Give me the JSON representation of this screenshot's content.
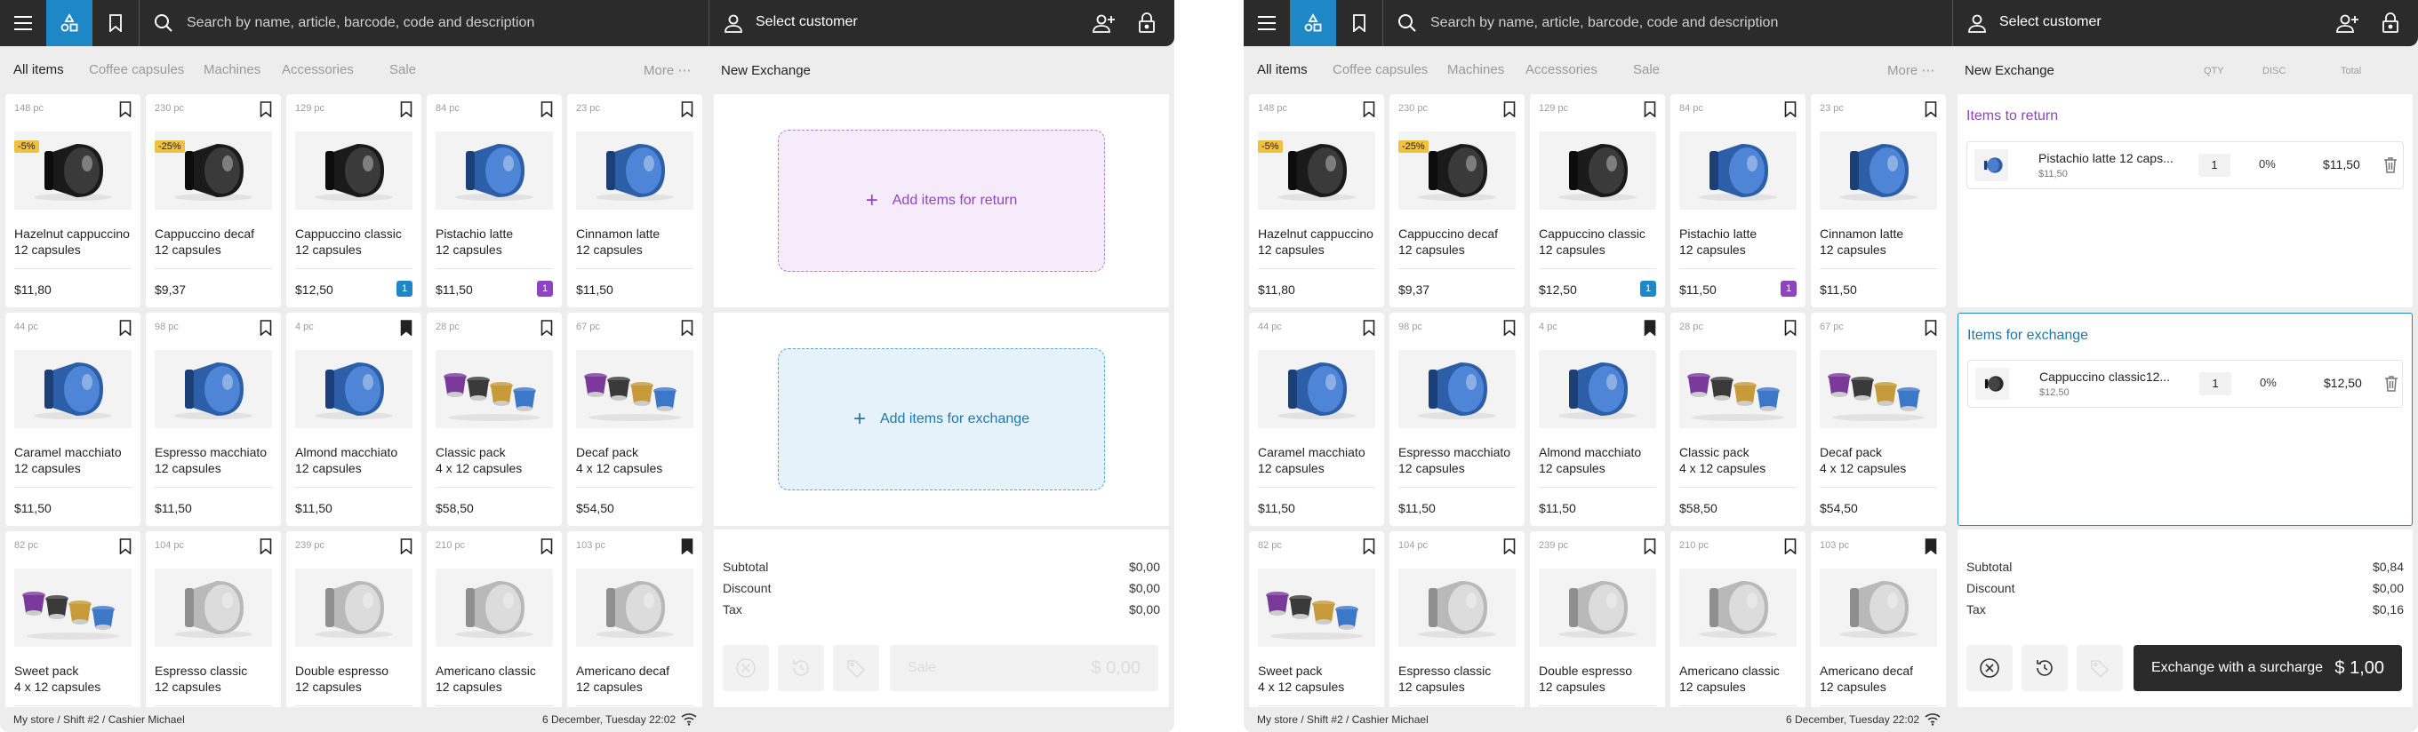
{
  "search": {
    "placeholder": "Search by name, article, barcode, code and description"
  },
  "customer": {
    "label": "Select customer"
  },
  "tabs": [
    "All items",
    "Coffee capsules",
    "Machines",
    "Accessories",
    "Sale"
  ],
  "more": "More",
  "panel_title": "New Exchange",
  "column_headers": {
    "qty": "QTY",
    "disc": "DISC",
    "total": "Total"
  },
  "products": [
    {
      "stock": "148 pc",
      "name1": "Hazelnut cappuccino",
      "name2": "12 capsules",
      "price": "$11,80",
      "discount": "-5%",
      "variant": "black",
      "bookmarked": false,
      "qty": ""
    },
    {
      "stock": "230 pc",
      "name1": "Cappuccino decaf",
      "name2": "12 capsules",
      "price": "$9,37",
      "discount": "-25%",
      "variant": "black",
      "bookmarked": false,
      "qty": ""
    },
    {
      "stock": "129 pc",
      "name1": "Cappuccino classic",
      "name2": "12 capsules",
      "price": "$12,50",
      "discount": "",
      "variant": "black",
      "bookmarked": false,
      "qty": "1",
      "qty_color": "#1e88c7"
    },
    {
      "stock": "84 pc",
      "name1": "Pistachio latte",
      "name2": "12 capsules",
      "price": "$11,50",
      "discount": "",
      "variant": "blue",
      "bookmarked": false,
      "qty": "1",
      "qty_color": "#8e44c0"
    },
    {
      "stock": "23 pc",
      "name1": "Cinnamon latte",
      "name2": "12 capsules",
      "price": "$11,50",
      "discount": "",
      "variant": "blue",
      "bookmarked": false,
      "qty": ""
    },
    {
      "stock": "44 pc",
      "name1": "Caramel macchiato",
      "name2": "12 capsules",
      "price": "$11,50",
      "discount": "",
      "variant": "blue",
      "bookmarked": false,
      "qty": ""
    },
    {
      "stock": "98 pc",
      "name1": "Espresso macchiato",
      "name2": "12 capsules",
      "price": "$11,50",
      "discount": "",
      "variant": "blue",
      "bookmarked": false,
      "qty": ""
    },
    {
      "stock": "4 pc",
      "name1": "Almond macchiato",
      "name2": "12 capsules",
      "price": "$11,50",
      "discount": "",
      "variant": "blue",
      "bookmarked": true,
      "qty": ""
    },
    {
      "stock": "28 pc",
      "name1": "Classic pack",
      "name2": "4 x 12 capsules",
      "price": "$58,50",
      "discount": "",
      "variant": "pack",
      "bookmarked": false,
      "qty": ""
    },
    {
      "stock": "67 pc",
      "name1": "Decaf pack",
      "name2": "4 x 12 capsules",
      "price": "$54,50",
      "discount": "",
      "variant": "pack",
      "bookmarked": false,
      "qty": ""
    },
    {
      "stock": "82 pc",
      "name1": "Sweet pack",
      "name2": "4 x 12 capsules",
      "price": "",
      "discount": "",
      "variant": "pack",
      "bookmarked": false,
      "qty": ""
    },
    {
      "stock": "104 pc",
      "name1": "Espresso classic",
      "name2": "12 capsules",
      "price": "",
      "discount": "",
      "variant": "silver",
      "bookmarked": false,
      "qty": ""
    },
    {
      "stock": "239 pc",
      "name1": "Double espresso",
      "name2": "12 capsules",
      "price": "",
      "discount": "",
      "variant": "silver",
      "bookmarked": false,
      "qty": ""
    },
    {
      "stock": "210 pc",
      "name1": "Americano classic",
      "name2": "12 capsules",
      "price": "",
      "discount": "",
      "variant": "silver",
      "bookmarked": false,
      "qty": ""
    },
    {
      "stock": "103 pc",
      "name1": "Americano decaf",
      "name2": "12 capsules",
      "price": "",
      "discount": "",
      "variant": "silver",
      "bookmarked": true,
      "qty": ""
    }
  ],
  "screen1": {
    "add_return": "Add items for return",
    "add_exchange": "Add items for exchange",
    "subtotal": "$0,00",
    "discount": "$0,00",
    "tax": "$0,00",
    "action_label": "Sale",
    "action_amount": "$ 0,00"
  },
  "screen2": {
    "return_title": "Items to return",
    "exchange_title": "Items for exchange",
    "return_item": {
      "name": "Pistachio latte 12 caps...",
      "price": "$11,50",
      "qty": "1",
      "disc": "0%",
      "total": "$11,50"
    },
    "exchange_item": {
      "name": "Cappuccino classic12...",
      "price": "$12,50",
      "qty": "1",
      "disc": "0%",
      "total": "$12,50"
    },
    "subtotal": "$0,84",
    "discount": "$0,00",
    "tax": "$0,16",
    "action_label": "Exchange with a surcharge",
    "action_amount": "$ 1,00"
  },
  "labels": {
    "subtotal": "Subtotal",
    "discount": "Discount",
    "tax": "Tax"
  },
  "status": {
    "path": "My store / Shift #2 / Cashier Michael",
    "datetime": "6 December, Tuesday 22:02"
  },
  "colors": {
    "accent": "#1e88c7",
    "purple": "#8e44c0",
    "topbar": "#2b2b2b"
  }
}
